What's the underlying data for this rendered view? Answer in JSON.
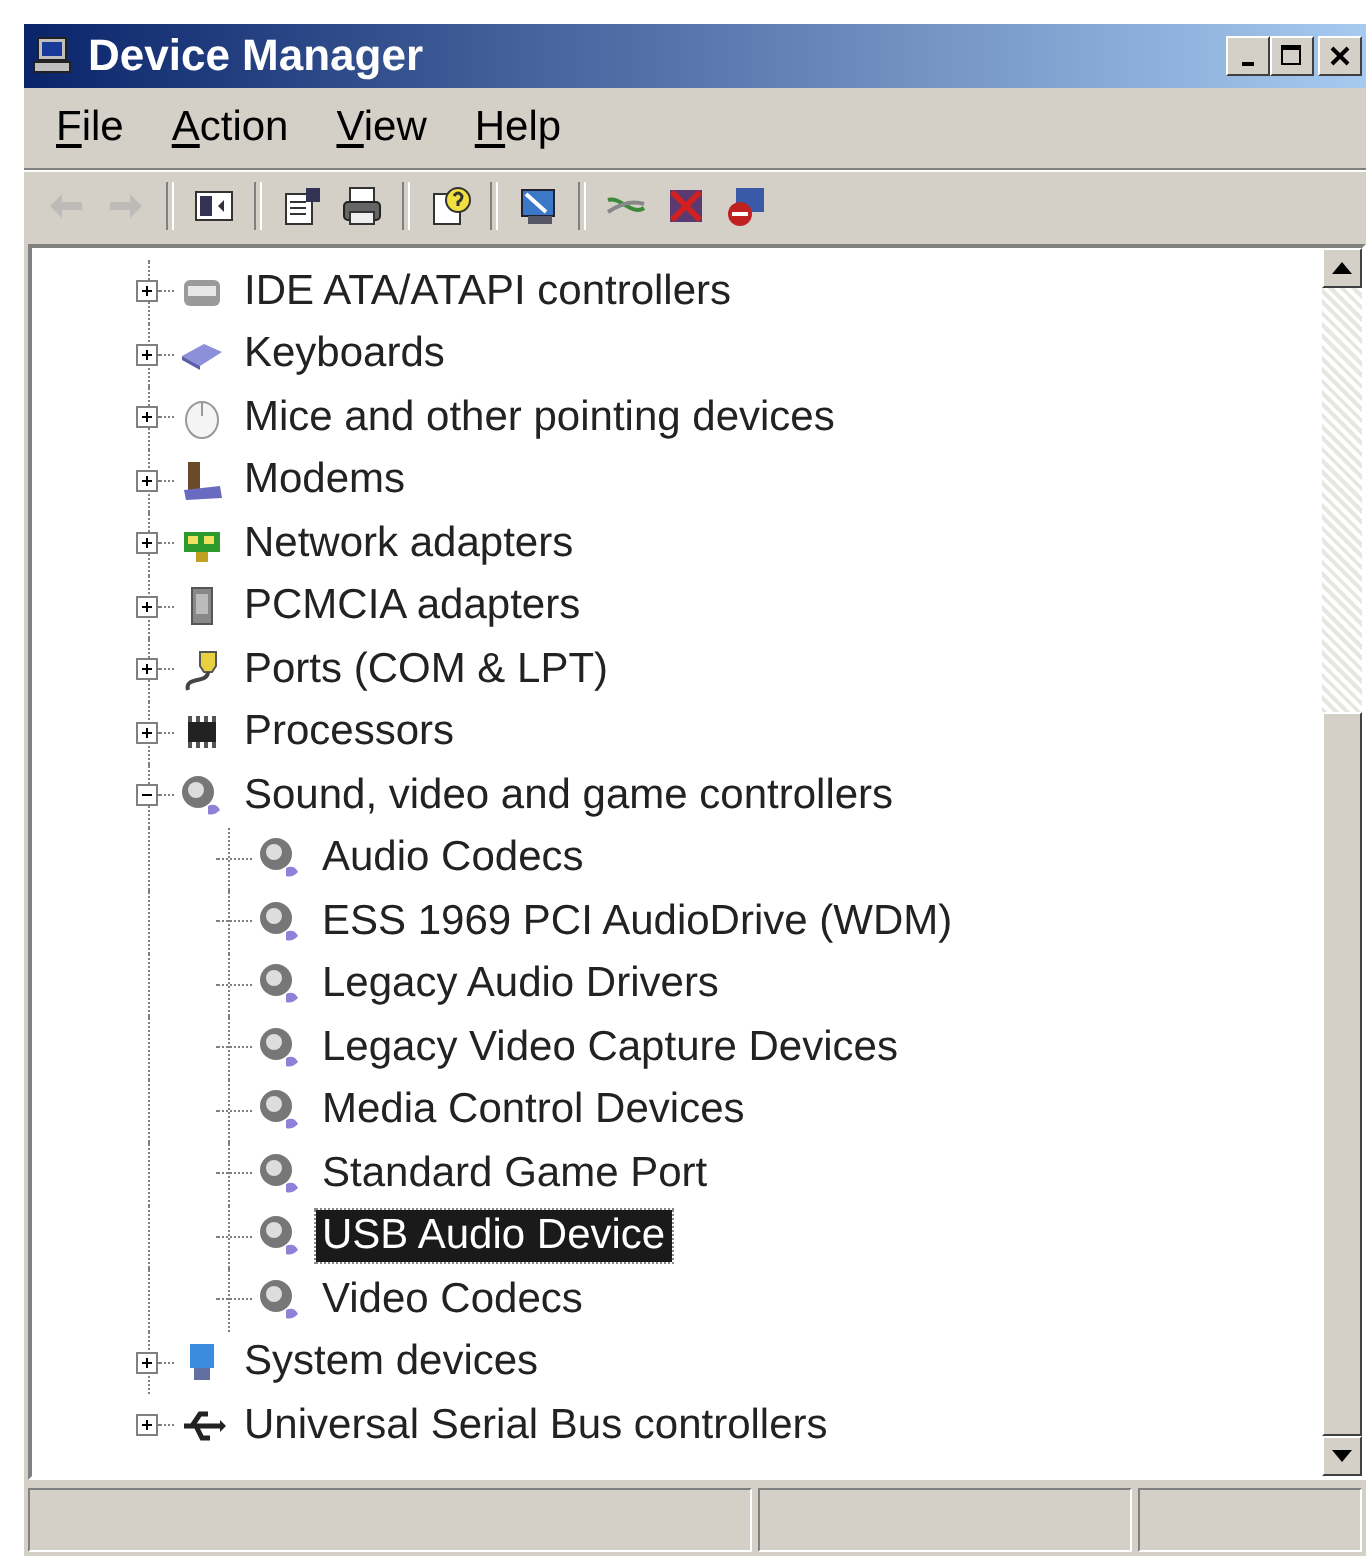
{
  "window": {
    "title": "Device Manager"
  },
  "menu": [
    {
      "label": "File"
    },
    {
      "label": "Action"
    },
    {
      "label": "View"
    },
    {
      "label": "Help"
    }
  ],
  "toolbar": [
    {
      "kind": "back",
      "disabled": true
    },
    {
      "kind": "forward",
      "disabled": true
    },
    {
      "kind": "sep"
    },
    {
      "kind": "tree",
      "disabled": false
    },
    {
      "kind": "sep"
    },
    {
      "kind": "properties",
      "disabled": false
    },
    {
      "kind": "print",
      "disabled": false
    },
    {
      "kind": "sep"
    },
    {
      "kind": "help",
      "disabled": false
    },
    {
      "kind": "sep"
    },
    {
      "kind": "scan",
      "disabled": false
    },
    {
      "kind": "sep"
    },
    {
      "kind": "update",
      "disabled": false
    },
    {
      "kind": "uninstall",
      "disabled": false
    },
    {
      "kind": "disable",
      "disabled": false
    }
  ],
  "tree": [
    {
      "label": "IDE ATA/ATAPI controllers",
      "kind": "disk",
      "expanded": false,
      "selected": false
    },
    {
      "label": "Keyboards",
      "kind": "keyboard",
      "expanded": false,
      "selected": false
    },
    {
      "label": "Mice and other pointing devices",
      "kind": "mouse",
      "expanded": false,
      "selected": false
    },
    {
      "label": "Modems",
      "kind": "modem",
      "expanded": false,
      "selected": false
    },
    {
      "label": "Network adapters",
      "kind": "card",
      "expanded": false,
      "selected": false
    },
    {
      "label": "PCMCIA adapters",
      "kind": "pcmcia",
      "expanded": false,
      "selected": false
    },
    {
      "label": "Ports (COM & LPT)",
      "kind": "port",
      "expanded": false,
      "selected": false
    },
    {
      "label": "Processors",
      "kind": "chip",
      "expanded": false,
      "selected": false
    },
    {
      "label": "Sound, video and game controllers",
      "kind": "speaker",
      "expanded": true,
      "selected": false,
      "children": [
        {
          "label": "Audio Codecs",
          "kind": "speaker",
          "selected": false
        },
        {
          "label": "ESS 1969 PCI AudioDrive (WDM)",
          "kind": "speaker",
          "selected": false
        },
        {
          "label": "Legacy Audio Drivers",
          "kind": "speaker",
          "selected": false
        },
        {
          "label": "Legacy Video Capture Devices",
          "kind": "speaker",
          "selected": false
        },
        {
          "label": "Media Control Devices",
          "kind": "speaker",
          "selected": false
        },
        {
          "label": "Standard Game Port",
          "kind": "speaker",
          "selected": false
        },
        {
          "label": "USB Audio Device",
          "kind": "speaker",
          "selected": true
        },
        {
          "label": "Video Codecs",
          "kind": "speaker",
          "selected": false
        }
      ]
    },
    {
      "label": "System devices",
      "kind": "system",
      "expanded": false,
      "selected": false
    },
    {
      "label": "Universal Serial Bus controllers",
      "kind": "usb",
      "expanded": false,
      "selected": false
    }
  ]
}
